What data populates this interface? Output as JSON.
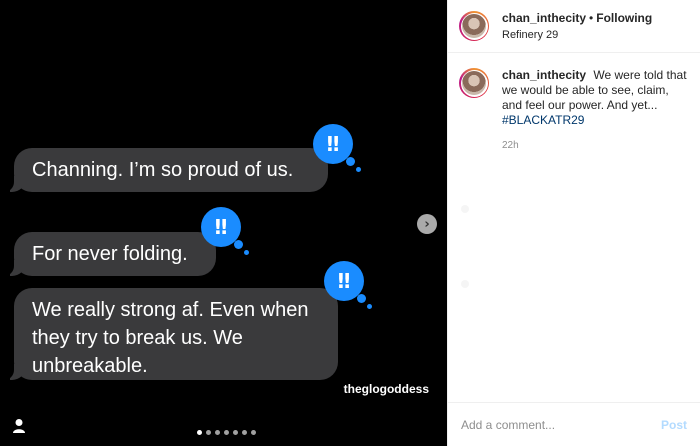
{
  "media": {
    "messages": [
      {
        "text": "Channing. I’m so proud of us."
      },
      {
        "text": "For never folding."
      },
      {
        "text": "We really strong af. Even when they try to break us. We unbreakable."
      }
    ],
    "reaction_glyph": "‼",
    "watermark": "theglogoddess",
    "next_glyph": "›",
    "carousel": {
      "count": 7,
      "active_index": 0
    }
  },
  "header": {
    "username": "chan_inthecity",
    "separator": "•",
    "follow_status": "Following",
    "location": "Refinery 29"
  },
  "caption": {
    "username": "chan_inthecity",
    "text": "We were told that we would be able to see, claim, and feel our power. And yet...",
    "hashtag": "#BLACKATR29",
    "time": "22h"
  },
  "comment": {
    "placeholder": "Add a comment...",
    "post_label": "Post"
  },
  "colors": {
    "reaction_blue": "#1a8cff",
    "bubble_gray": "#3a3a3c",
    "link_blue": "#00376b",
    "post_disabled": "#b3dbff"
  },
  "icons": {
    "user_tag": "user-icon",
    "next": "chevron-right-icon",
    "reaction": "double-exclamation-icon"
  }
}
